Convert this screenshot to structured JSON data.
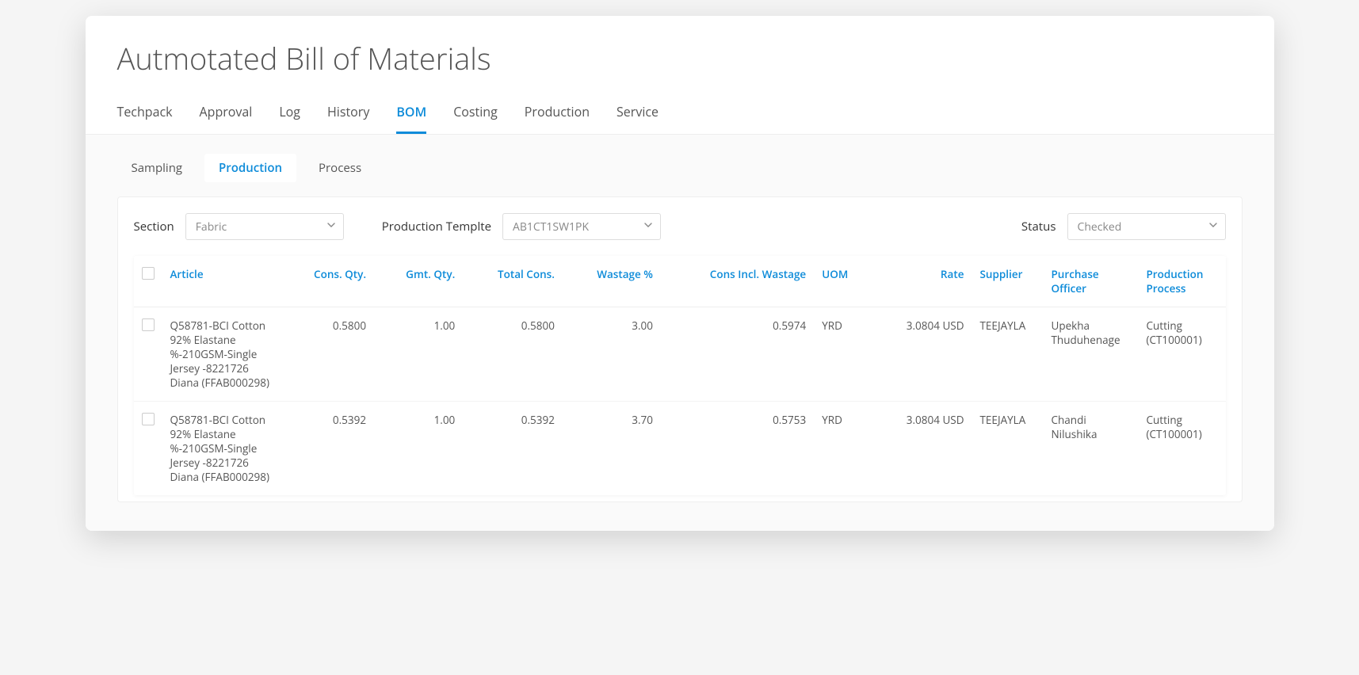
{
  "page_title": "Autmotated Bill of Materials",
  "tabs_primary": [
    {
      "label": "Techpack",
      "active": false
    },
    {
      "label": "Approval",
      "active": false
    },
    {
      "label": "Log",
      "active": false
    },
    {
      "label": "History",
      "active": false
    },
    {
      "label": "BOM",
      "active": true
    },
    {
      "label": "Costing",
      "active": false
    },
    {
      "label": "Production",
      "active": false
    },
    {
      "label": "Service",
      "active": false
    }
  ],
  "tabs_secondary": [
    {
      "label": "Sampling",
      "active": false
    },
    {
      "label": "Production",
      "active": true
    },
    {
      "label": "Process",
      "active": false
    }
  ],
  "filters": {
    "section_label": "Section",
    "section_value": "Fabric",
    "template_label": "Production Templte",
    "template_value": "AB1CT1SW1PK",
    "status_label": "Status",
    "status_value": "Checked"
  },
  "table": {
    "headers": {
      "article": "Article",
      "cons_qty": "Cons. Qty.",
      "gmt_qty": "Gmt. Qty.",
      "total_cons": "Total Cons.",
      "wastage_pct": "Wastage %",
      "cons_incl_wastage": "Cons Incl. Wastage",
      "uom": "UOM",
      "rate": "Rate",
      "supplier": "Supplier",
      "purchase_officer": "Purchase Officer",
      "production_process": "Production Process"
    },
    "rows": [
      {
        "article": "Q58781-BCI Cotton 92% Elastane %-210GSM-Single Jersey -8221726 Diana (FFAB000298)",
        "cons_qty": "0.5800",
        "gmt_qty": "1.00",
        "total_cons": "0.5800",
        "wastage_pct": "3.00",
        "cons_incl_wastage": "0.5974",
        "uom": "YRD",
        "rate": "3.0804 USD",
        "supplier": "TEEJAYLA",
        "purchase_officer": "Upekha Thuduhenage",
        "production_process": "Cutting (CT100001)"
      },
      {
        "article": "Q58781-BCI Cotton 92% Elastane %-210GSM-Single Jersey -8221726 Diana (FFAB000298)",
        "cons_qty": "0.5392",
        "gmt_qty": "1.00",
        "total_cons": "0.5392",
        "wastage_pct": "3.70",
        "cons_incl_wastage": "0.5753",
        "uom": "YRD",
        "rate": "3.0804 USD",
        "supplier": "TEEJAYLA",
        "purchase_officer": "Chandi Nilushika",
        "production_process": "Cutting (CT100001)"
      }
    ]
  }
}
